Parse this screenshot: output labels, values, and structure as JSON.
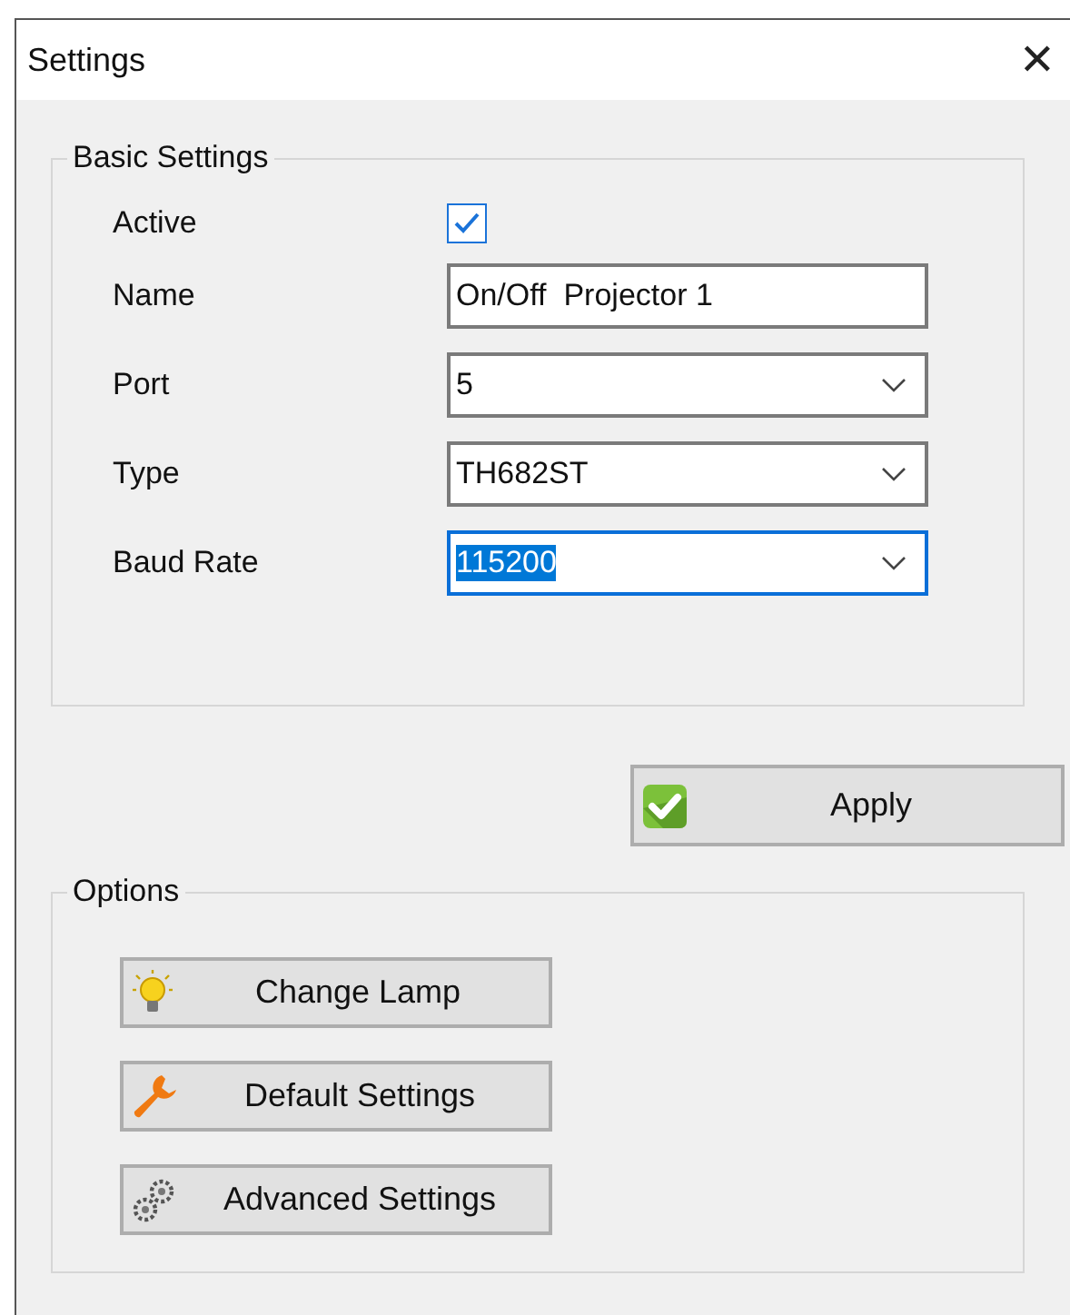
{
  "window": {
    "title": "Settings",
    "close": "✕"
  },
  "basic_settings": {
    "title": "Basic Settings",
    "fields": [
      {
        "label": "Active",
        "kind": "checkbox",
        "checked": true
      },
      {
        "label": "Name",
        "kind": "text",
        "value": "On/Off  Projector 1"
      },
      {
        "label": "Port",
        "kind": "dropdown",
        "value": "5",
        "focused": false
      },
      {
        "label": "Type",
        "kind": "dropdown",
        "value": "TH682ST",
        "focused": false
      },
      {
        "label": "Baud Rate",
        "kind": "dropdown",
        "value": "115200",
        "focused": true
      }
    ]
  },
  "apply_button": {
    "label": "Apply"
  },
  "options": {
    "title": "Options",
    "buttons": [
      {
        "label": "Change Lamp",
        "kind": "lamp"
      },
      {
        "label": "Default Settings",
        "kind": "wrench"
      },
      {
        "label": "Advanced Settings",
        "kind": "gears"
      }
    ]
  }
}
